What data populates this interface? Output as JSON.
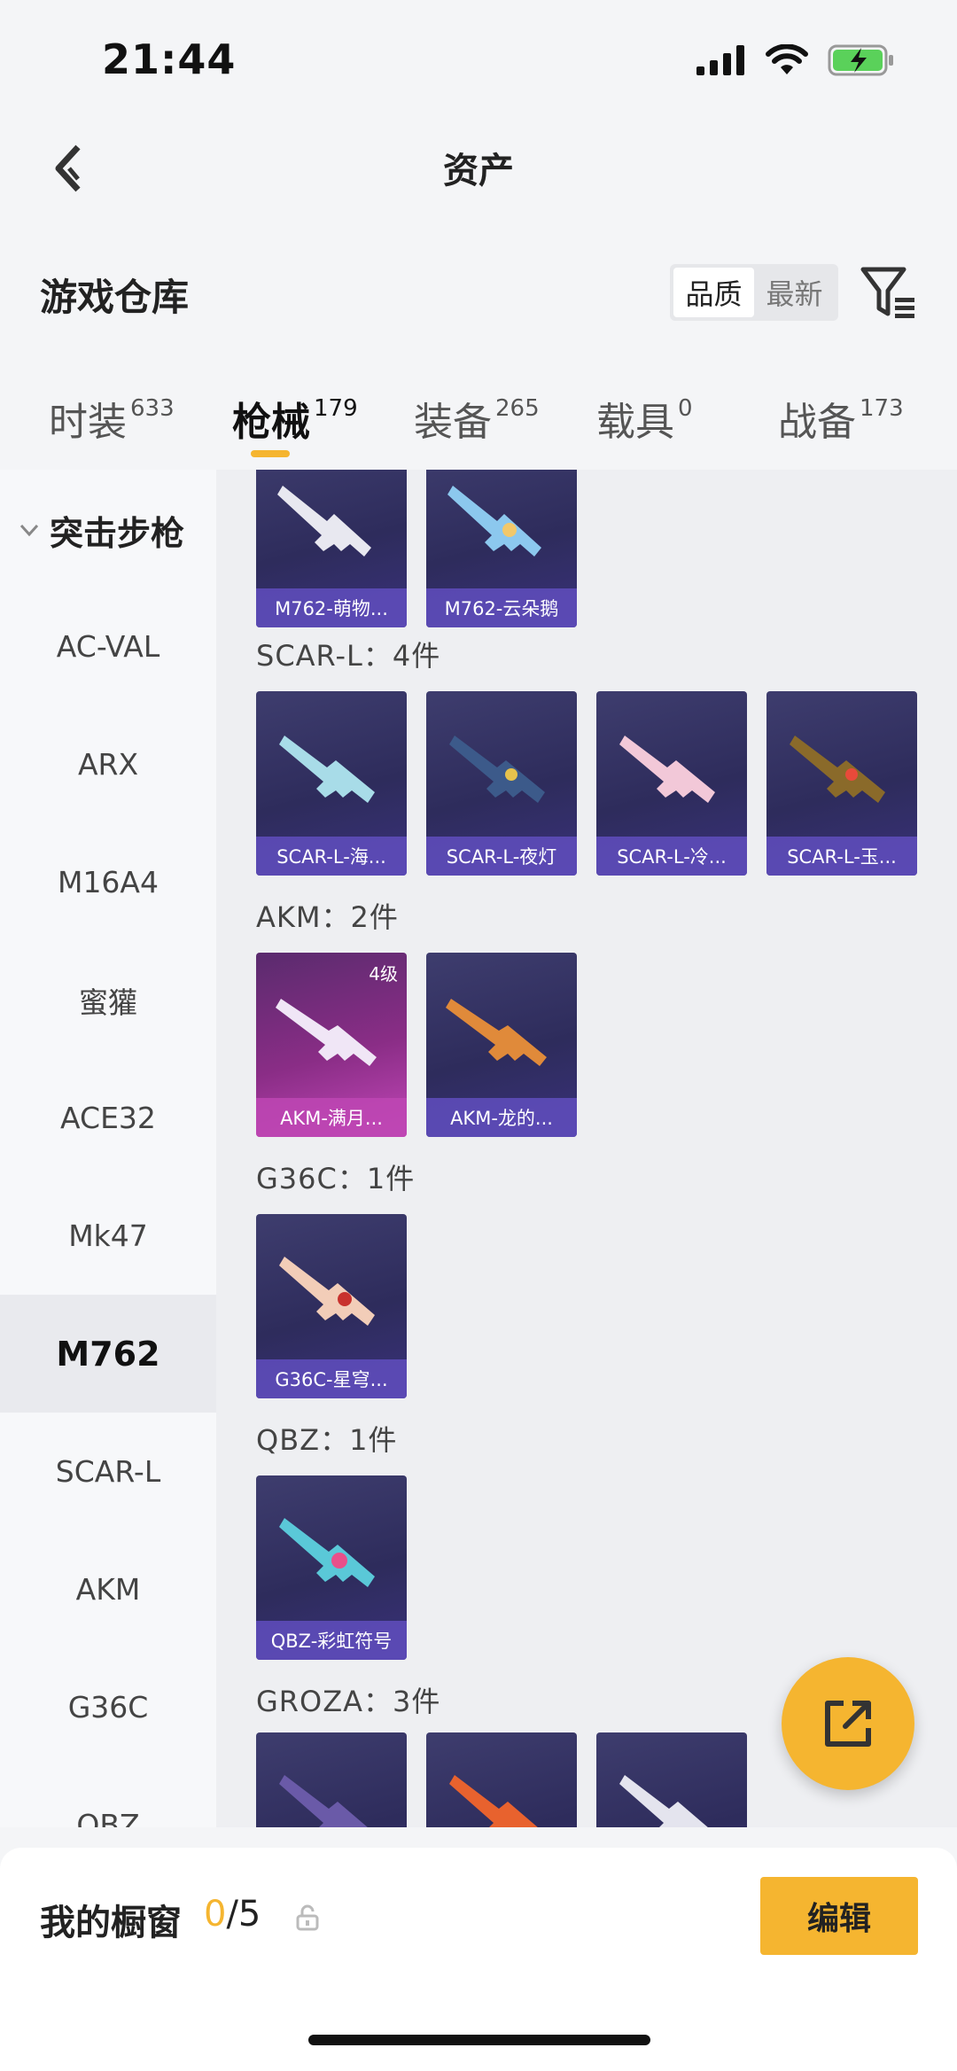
{
  "status": {
    "time": "21:44"
  },
  "nav": {
    "title": "资产"
  },
  "warehouse": {
    "title": "游戏仓库",
    "sort_options": [
      "品质",
      "最新"
    ],
    "sort_selected": "品质"
  },
  "tabs": [
    {
      "label": "时装",
      "count": "633"
    },
    {
      "label": "枪械",
      "count": "179",
      "active": true
    },
    {
      "label": "装备",
      "count": "265"
    },
    {
      "label": "载具",
      "count": "0"
    },
    {
      "label": "战备",
      "count": "173"
    }
  ],
  "sidebar": {
    "group": "突击步枪",
    "items": [
      "AC-VAL",
      "ARX",
      "M16A4",
      "蜜獾",
      "ACE32",
      "Mk47",
      "M762",
      "SCAR-L",
      "AKM",
      "G36C",
      "QBZ"
    ],
    "selected": "M762"
  },
  "sections": [
    {
      "title": "",
      "items": [
        "M762-萌物...",
        "M762-云朵鹅"
      ]
    },
    {
      "title": "SCAR-L：4件",
      "items": [
        "SCAR-L-海...",
        "SCAR-L-夜灯",
        "SCAR-L-冷...",
        "SCAR-L-玉..."
      ]
    },
    {
      "title": "AKM：2件",
      "items": [
        "AKM-满月...",
        "AKM-龙的..."
      ],
      "first_level": "4级"
    },
    {
      "title": "G36C：1件",
      "items": [
        "G36C-星穹..."
      ]
    },
    {
      "title": "QBZ：1件",
      "items": [
        "QBZ-彩虹符号"
      ]
    },
    {
      "title": "GROZA：3件",
      "items": [
        "",
        "",
        ""
      ]
    }
  ],
  "showcase": {
    "label": "我的橱窗",
    "current": "0",
    "total": "/5"
  },
  "edit_button": "编辑",
  "colors": {
    "accent": "#f5b530",
    "card_bg": "#2e2c5c",
    "card_label": "#604ebe"
  }
}
